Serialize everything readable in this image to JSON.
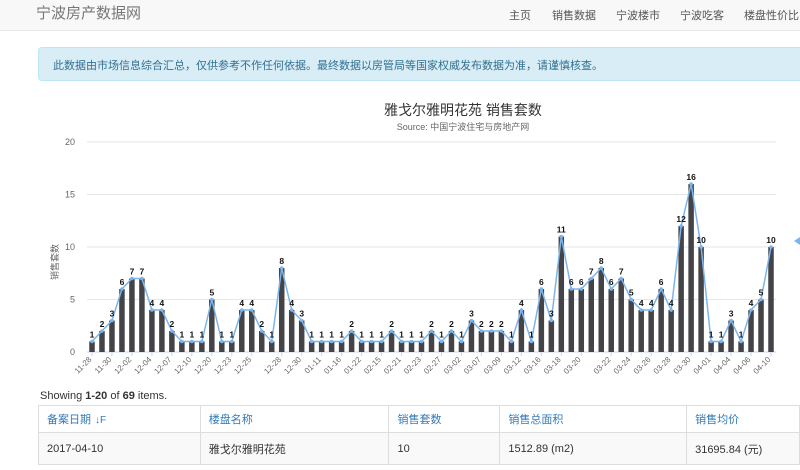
{
  "navbar": {
    "brand": "宁波房产数据网",
    "items": [
      {
        "label": "主页"
      },
      {
        "label": "销售数据"
      },
      {
        "label": "宁波楼市"
      },
      {
        "label": "宁波吃客"
      },
      {
        "label": "楼盘性价比"
      }
    ]
  },
  "notice": "此数据由市场信息综合汇总，仅供参考不作任何依据。最终数据以房管局等国家权威发布数据为准，请谨慎核查。",
  "chart_data": {
    "type": "bar",
    "title": "雅戈尔雅明花苑 销售套数",
    "subtitle": "Source: 中国宁波住宅与房地产网",
    "ylabel": "销售套数",
    "ylim": [
      0,
      20
    ],
    "yticks": [
      0,
      5,
      10,
      15,
      20
    ],
    "grid": true,
    "bar_color": "#434348",
    "line_color": "#7cb5ec",
    "values": [
      1,
      2,
      3,
      6,
      7,
      7,
      4,
      4,
      2,
      1,
      1,
      1,
      5,
      1,
      1,
      4,
      4,
      2,
      1,
      8,
      4,
      3,
      1,
      1,
      1,
      1,
      2,
      1,
      1,
      1,
      2,
      1,
      1,
      1,
      2,
      1,
      2,
      1,
      3,
      2,
      2,
      2,
      1,
      4,
      1,
      6,
      3,
      11,
      6,
      6,
      7,
      8,
      6,
      7,
      5,
      4,
      4,
      6,
      4,
      12,
      16,
      10,
      1,
      1,
      3,
      1,
      4,
      5,
      10
    ],
    "tick_labels": [
      "11-28",
      "11-30",
      "12-02",
      "12-04",
      "12-07",
      "12-10",
      "12-20",
      "12-23",
      "12-25",
      "12-28",
      "12-30",
      "01-11",
      "01-16",
      "01-22",
      "02-15",
      "02-21",
      "02-23",
      "02-27",
      "03-02",
      "03-07",
      "03-09",
      "03-12",
      "03-16",
      "03-18",
      "03-20",
      "03-22",
      "03-24",
      "03-26",
      "03-28",
      "03-30",
      "04-01",
      "04-04",
      "04-06",
      "04-10"
    ]
  },
  "table": {
    "summary_prefix": "Showing ",
    "summary_range": "1-20",
    "summary_mid": " of ",
    "summary_total": "69",
    "summary_suffix": " items.",
    "headers": [
      "备案日期",
      "楼盘名称",
      "销售套数",
      "销售总面积",
      "销售均价"
    ],
    "sort_icon": "sort-desc-icon",
    "rows": [
      [
        "2017-04-10",
        "雅戈尔雅明花苑",
        "10",
        "1512.89 (m2)",
        "31695.84 (元)"
      ]
    ]
  }
}
